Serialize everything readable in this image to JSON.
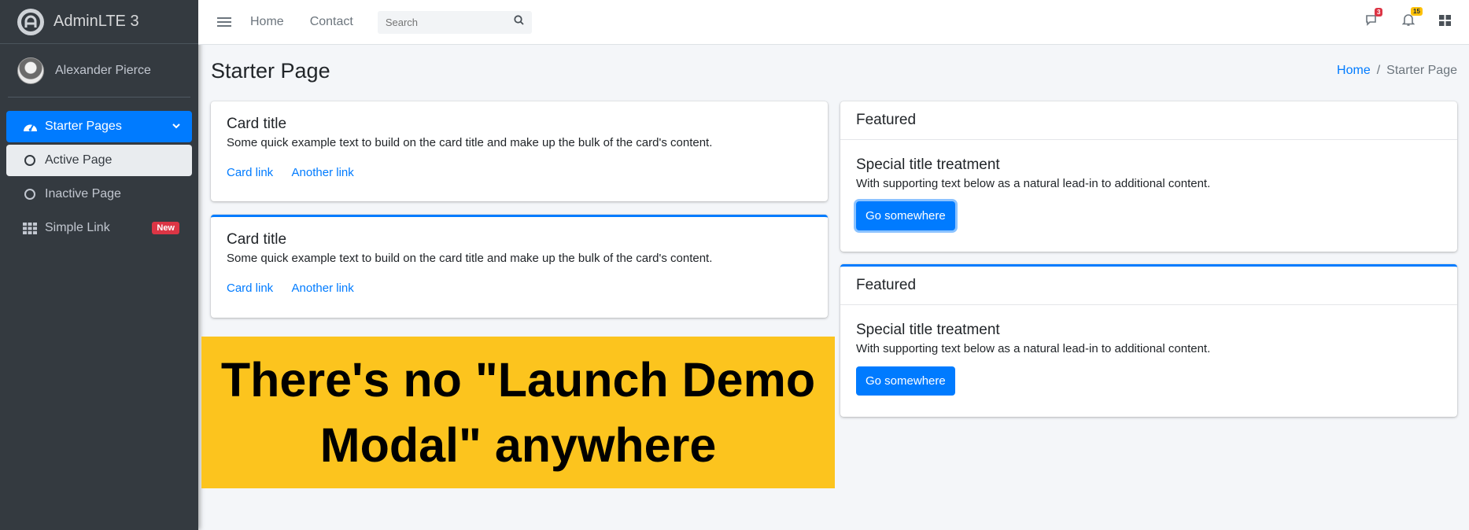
{
  "brand": {
    "name": "AdminLTE 3"
  },
  "user": {
    "name": "Alexander Pierce"
  },
  "sidebar": {
    "items": [
      {
        "label": "Starter Pages"
      },
      {
        "label": "Active Page"
      },
      {
        "label": "Inactive Page"
      },
      {
        "label": "Simple Link",
        "badge": "New"
      }
    ]
  },
  "topnav": {
    "links": [
      "Home",
      "Contact"
    ],
    "search_placeholder": "Search",
    "messages_count": "3",
    "notifications_count": "15"
  },
  "page": {
    "title": "Starter Page",
    "breadcrumb": [
      "Home",
      "Starter Page"
    ]
  },
  "cards_left": [
    {
      "title": "Card title",
      "text": "Some quick example text to build on the card title and make up the bulk of the card's content.",
      "link1": "Card link",
      "link2": "Another link"
    },
    {
      "title": "Card title",
      "text": "Some quick example text to build on the card title and make up the bulk of the card's content.",
      "link1": "Card link",
      "link2": "Another link"
    }
  ],
  "cards_right": [
    {
      "header": "Featured",
      "title": "Special title treatment",
      "text": "With supporting text below as a natural lead-in to additional content.",
      "button": "Go somewhere"
    },
    {
      "header": "Featured",
      "title": "Special title treatment",
      "text": "With supporting text below as a natural lead-in to additional content.",
      "button": "Go somewhere"
    }
  ],
  "overlay": {
    "text": "There's no \"Launch Demo Modal\" anywhere"
  },
  "colors": {
    "primary": "#007bff",
    "sidebar": "#343a40",
    "danger": "#dc3545",
    "warning": "#ffc107",
    "overlay": "#fcc41e"
  }
}
